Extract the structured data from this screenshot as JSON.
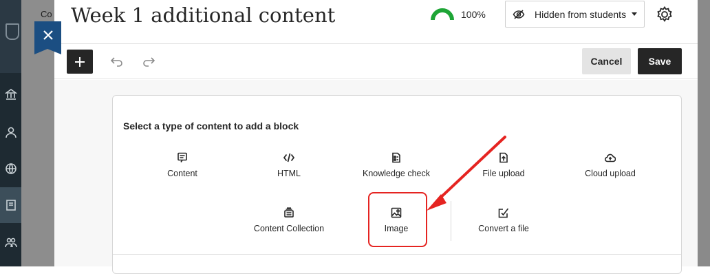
{
  "background": {
    "breadcrumb_fragment": "Co"
  },
  "icons": {
    "close": "close-icon",
    "add": "plus-icon",
    "undo": "undo-icon",
    "redo": "redo-icon",
    "visibility": "eye-slash-icon",
    "settings": "gear-icon",
    "dropdown": "chevron-down-icon"
  },
  "header": {
    "title": "Week 1 additional content",
    "progress_value": 100,
    "progress_label": "100%",
    "visibility_label": "Hidden from students"
  },
  "toolbar": {
    "cancel_label": "Cancel",
    "save_label": "Save"
  },
  "picker": {
    "title": "Select a type of content to add a block",
    "options": [
      {
        "label": "Content",
        "icon": "document-text-icon"
      },
      {
        "label": "HTML",
        "icon": "code-icon"
      },
      {
        "label": "Knowledge check",
        "icon": "checklist-icon"
      },
      {
        "label": "File upload",
        "icon": "file-upload-icon"
      },
      {
        "label": "Cloud upload",
        "icon": "cloud-upload-icon"
      },
      {
        "label": "Content Collection",
        "icon": "collection-icon"
      },
      {
        "label": "Image",
        "icon": "image-icon"
      },
      {
        "label": "Convert a file",
        "icon": "convert-file-icon"
      }
    ],
    "highlighted_option": "Image"
  },
  "colors": {
    "accent_dark": "#262626",
    "close_tab": "#1b4e82",
    "progress": "#1ea536",
    "annotation": "#e52421"
  }
}
